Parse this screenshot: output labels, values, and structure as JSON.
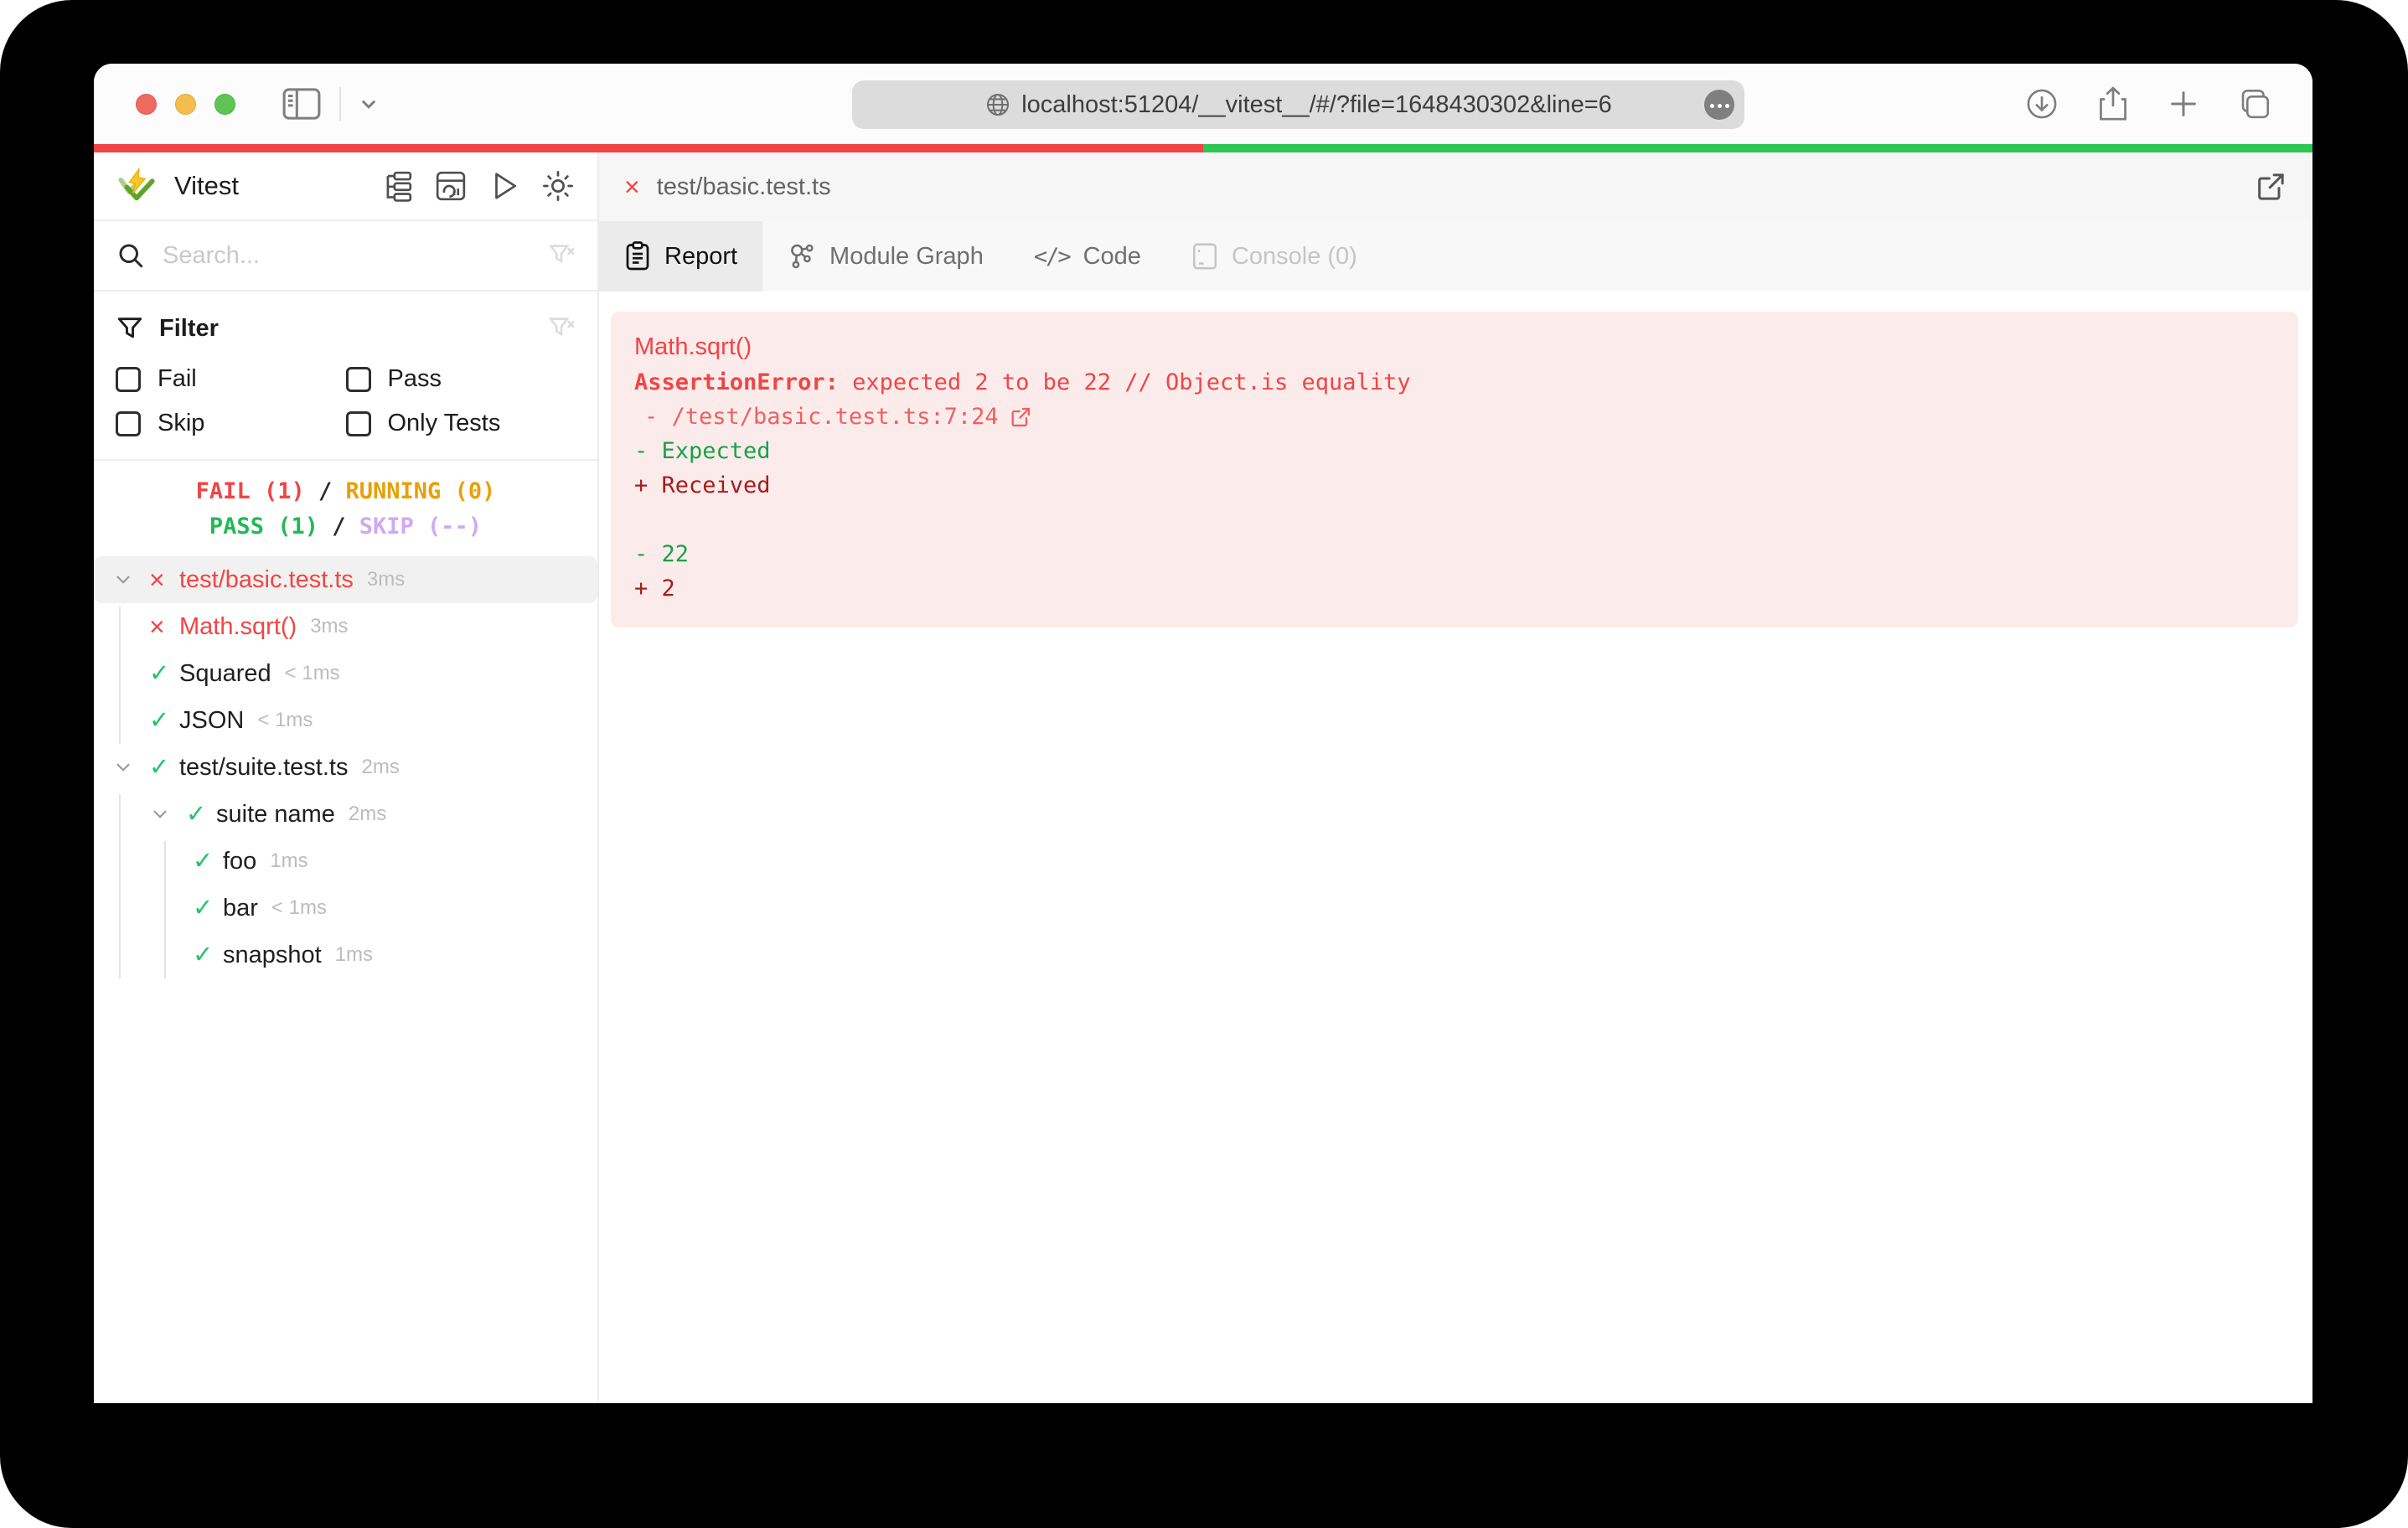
{
  "browser": {
    "url": "localhost:51204/__vitest__/#/?file=1648430302&line=6"
  },
  "progress": {
    "fail_fraction": "50%",
    "pass_fraction": "50%",
    "fail_color": "#ef4444",
    "pass_color": "#2dc653"
  },
  "sidebar": {
    "title": "Vitest",
    "search": {
      "placeholder": "Search..."
    },
    "filter": {
      "heading": "Filter",
      "options": [
        {
          "label": "Fail",
          "checked": false
        },
        {
          "label": "Pass",
          "checked": false
        },
        {
          "label": "Skip",
          "checked": false
        },
        {
          "label": "Only Tests",
          "checked": false
        }
      ]
    },
    "status": {
      "fail": "FAIL (1)",
      "sep1": "/",
      "running": "RUNNING (0)",
      "pass": "PASS (1)",
      "sep2": "/",
      "skip": "SKIP (--)"
    },
    "tree": [
      {
        "label": "test/basic.test.ts",
        "duration": "3ms",
        "status": "fail",
        "selected": true
      },
      {
        "label": "Math.sqrt()",
        "duration": "3ms",
        "status": "fail",
        "selected": false
      },
      {
        "label": "Squared",
        "duration": "< 1ms",
        "status": "pass",
        "selected": false
      },
      {
        "label": "JSON",
        "duration": "< 1ms",
        "status": "pass",
        "selected": false
      },
      {
        "label": "test/suite.test.ts",
        "duration": "2ms",
        "status": "pass",
        "selected": false
      },
      {
        "label": "suite name",
        "duration": "2ms",
        "status": "pass",
        "selected": false
      },
      {
        "label": "foo",
        "duration": "1ms",
        "status": "pass",
        "selected": false
      },
      {
        "label": "bar",
        "duration": "< 1ms",
        "status": "pass",
        "selected": false
      },
      {
        "label": "snapshot",
        "duration": "1ms",
        "status": "pass",
        "selected": false
      }
    ]
  },
  "main": {
    "file": {
      "label": "test/basic.test.ts"
    },
    "tabs": [
      {
        "label": "Report",
        "active": true
      },
      {
        "label": "Module Graph",
        "active": false
      },
      {
        "label": "Code",
        "active": false
      },
      {
        "label": "Console (0)",
        "active": false,
        "disabled": true
      }
    ],
    "error": {
      "test_name": "Math.sqrt()",
      "name": "AssertionError:",
      "message": " expected 2 to be 22 // Object.is equality",
      "location": "- /test/basic.test.ts:7:24",
      "diff": {
        "expected_label": "- Expected",
        "received_label": "+ Received",
        "expected_value": "- 22",
        "received_value": "+ 2"
      }
    }
  },
  "colors": {
    "fail": "#f04545",
    "pass": "#27c26b",
    "running": "#e7a008",
    "skip": "#cfa9f2",
    "diff_expected": "#16a34a",
    "diff_received": "#a81c1c",
    "error_background": "#fcebeb"
  }
}
